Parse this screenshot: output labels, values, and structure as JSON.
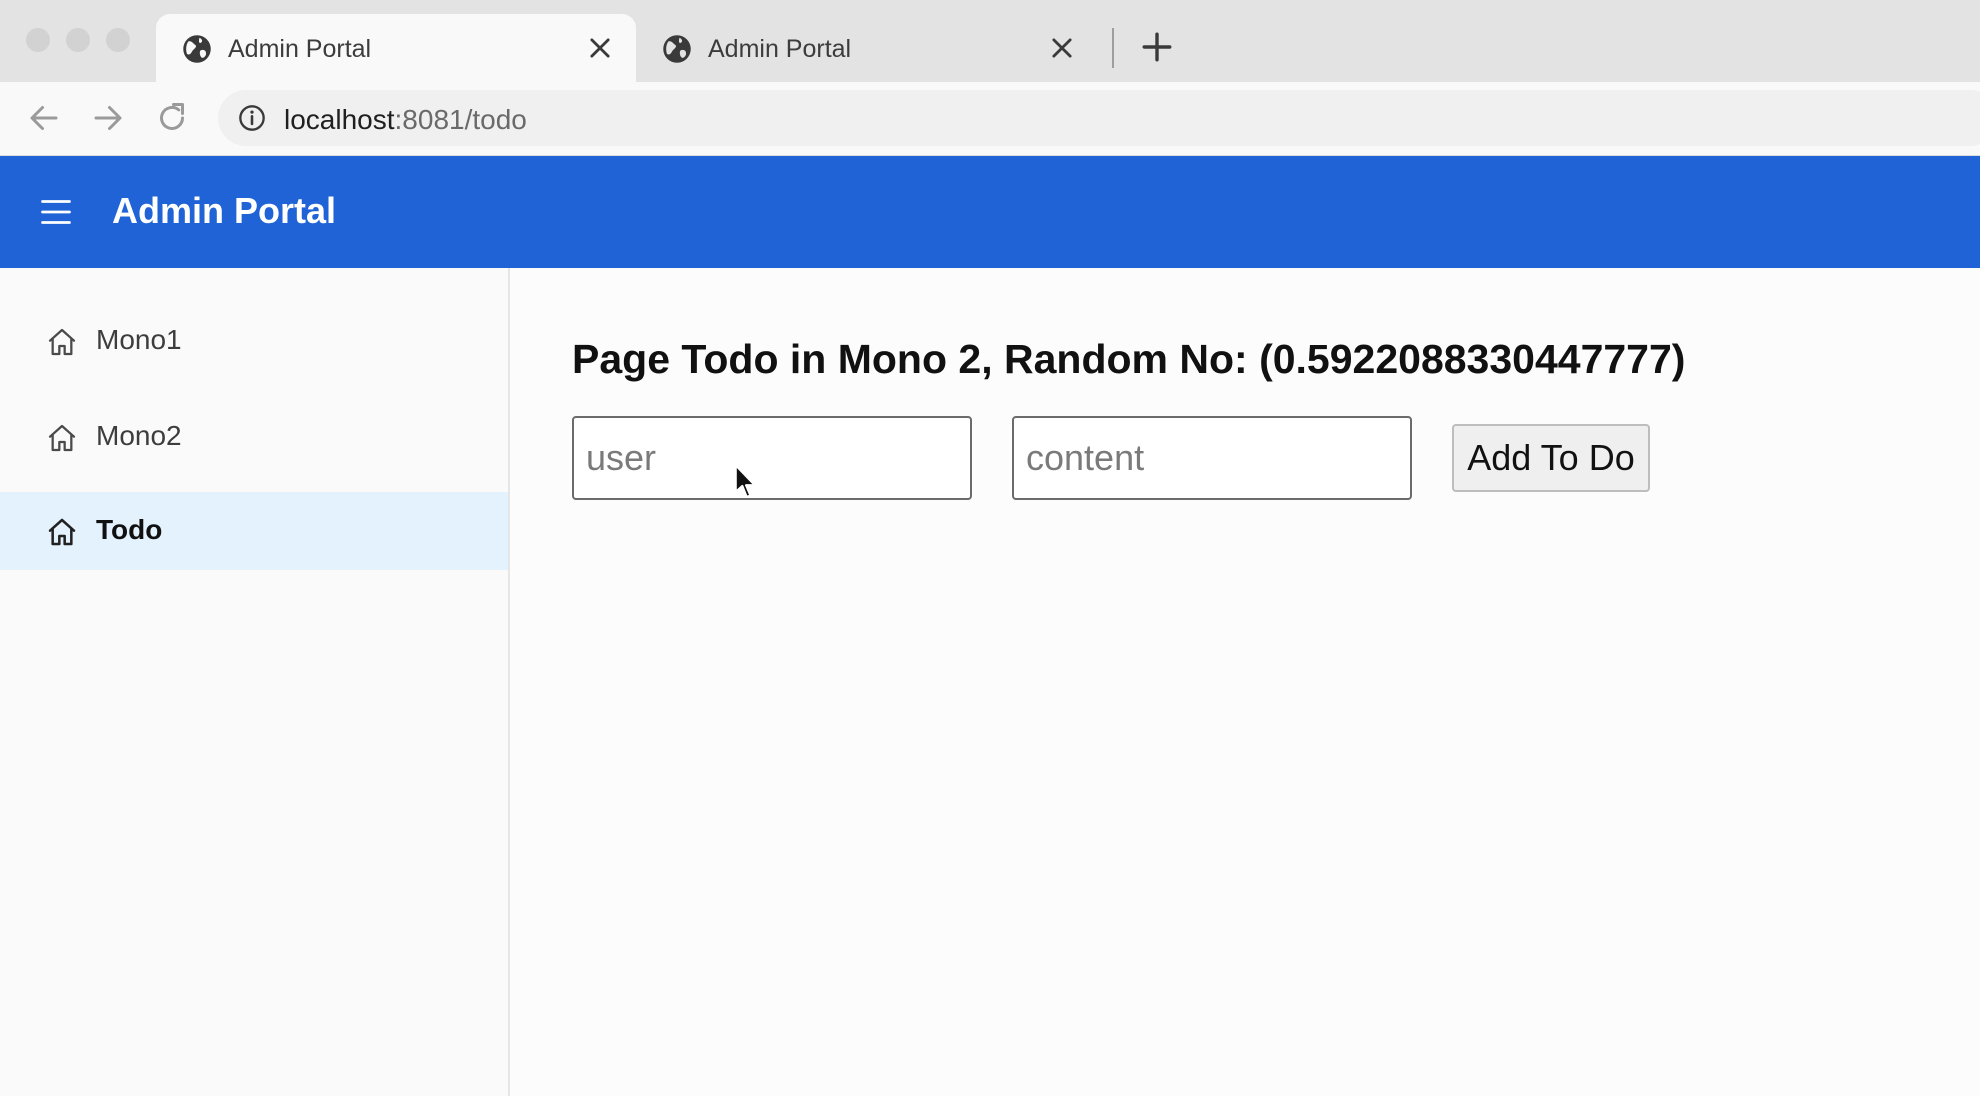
{
  "browser": {
    "tabs": [
      {
        "title": "Admin Portal",
        "active": true
      },
      {
        "title": "Admin Portal",
        "active": false
      }
    ],
    "url": {
      "host": "localhost",
      "rest": ":8081/todo"
    }
  },
  "app": {
    "title": "Admin Portal",
    "accent_color": "#1f63d6",
    "sidebar": {
      "items": [
        {
          "label": "Mono1",
          "icon": "home-icon",
          "selected": false
        },
        {
          "label": "Mono2",
          "icon": "home-icon",
          "selected": false
        },
        {
          "label": "Todo",
          "icon": "home-icon",
          "selected": true
        }
      ],
      "selected_color": "#e3f2fd"
    },
    "main": {
      "heading": "Page Todo in Mono 2, Random No: (0.5922088330447777)",
      "user_placeholder": "user",
      "content_placeholder": "content",
      "add_button_label": "Add To Do"
    }
  }
}
